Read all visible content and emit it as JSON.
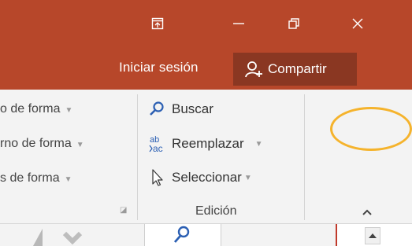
{
  "window": {
    "ribbon_display_icon": "ribbon-display-options-icon",
    "minimize_icon": "minimize-icon",
    "restore_icon": "restore-icon",
    "close_icon": "close-icon"
  },
  "account": {
    "signin_label": "Iniciar sesión",
    "share_label": "Compartir",
    "share_icon": "add-person-icon"
  },
  "drawing_group": {
    "items": [
      {
        "label": "o de forma"
      },
      {
        "label": "rno de forma"
      },
      {
        "label": "s de forma"
      }
    ]
  },
  "editing_group": {
    "label": "Edición",
    "find_label": "Buscar",
    "replace_label": "Reemplazar",
    "select_label": "Seleccionar"
  },
  "ribbon": {
    "collapse_icon": "chevron-up-icon"
  },
  "colors": {
    "titlebar": "#b7472a",
    "share_button": "#8a3722",
    "ribbon": "#f3f3f3",
    "highlight": "#f5b32c"
  }
}
